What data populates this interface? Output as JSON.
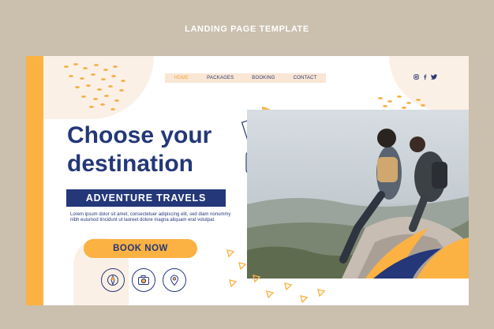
{
  "page": {
    "caption": "LANDING PAGE TEMPLATE"
  },
  "nav": {
    "items": [
      "HOME",
      "PACKAGES",
      "BOOKING",
      "CONTACT"
    ],
    "active": "HOME"
  },
  "social": [
    "instagram-icon",
    "facebook-icon",
    "twitter-icon"
  ],
  "hero": {
    "headline_1": "Choose your",
    "headline_2": "destination",
    "banner": "ADVENTURE TRAVELS",
    "body": "Lorem ipsum dolor sit amet, consectetuer adipiscing elit, sed diam nonummy nibh euismod tincidunt ut laoreet dolore magna aliquam erat volutpat.",
    "cta": "BOOK NOW"
  },
  "feature_icons": [
    "compass-icon",
    "camera-icon",
    "map-pin-icon"
  ],
  "colors": {
    "accent": "#fbb243",
    "navy": "#243778",
    "cream": "#fbf0e6",
    "background": "#cbbfae"
  }
}
